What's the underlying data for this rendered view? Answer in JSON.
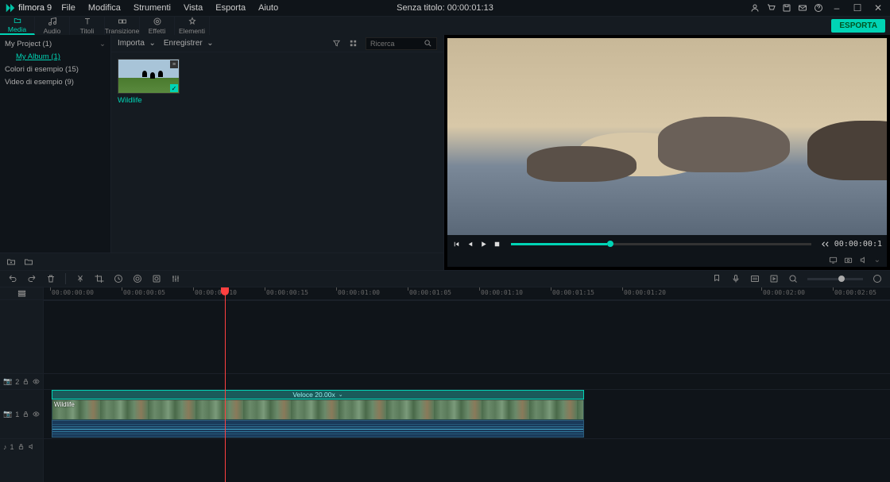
{
  "app": {
    "name": "filmora 9"
  },
  "menu": [
    "File",
    "Modifica",
    "Strumenti",
    "Vista",
    "Esporta",
    "Aiuto"
  ],
  "title": "Senza titolo:  00:00:01:13",
  "tabs": [
    {
      "label": "Media"
    },
    {
      "label": "Audio"
    },
    {
      "label": "Titoli"
    },
    {
      "label": "Transizione"
    },
    {
      "label": "Effetti"
    },
    {
      "label": "Elementi"
    }
  ],
  "export_label": "ESPORTA",
  "folders": {
    "project": "My Project (1)",
    "album": "My Album (1)",
    "colors": "Colori di esempio (15)",
    "videos": "Video di esempio (9)"
  },
  "media_tb": {
    "import": "Importa",
    "record": "Enregistrer"
  },
  "search": {
    "placeholder": "Ricerca"
  },
  "thumb": {
    "label": "Wildlife"
  },
  "preview": {
    "tc": "00:00:00:1"
  },
  "ruler_ticks": [
    "00:00:00:00",
    "00:00:00:05",
    "00:00:00:10",
    "00:00:00:15",
    "00:00:01:00",
    "00:00:01:05",
    "00:00:01:10",
    "00:00:01:15",
    "00:00:01:20",
    "00:00:02:00",
    "00:00:02:05"
  ],
  "clip": {
    "speed": "Veloce 20.00x",
    "name": "Wildlife"
  },
  "track_labels": {
    "v2": "2",
    "v1": "1",
    "a1": "1"
  },
  "icons": {
    "v": "📷",
    "a": "♪"
  }
}
